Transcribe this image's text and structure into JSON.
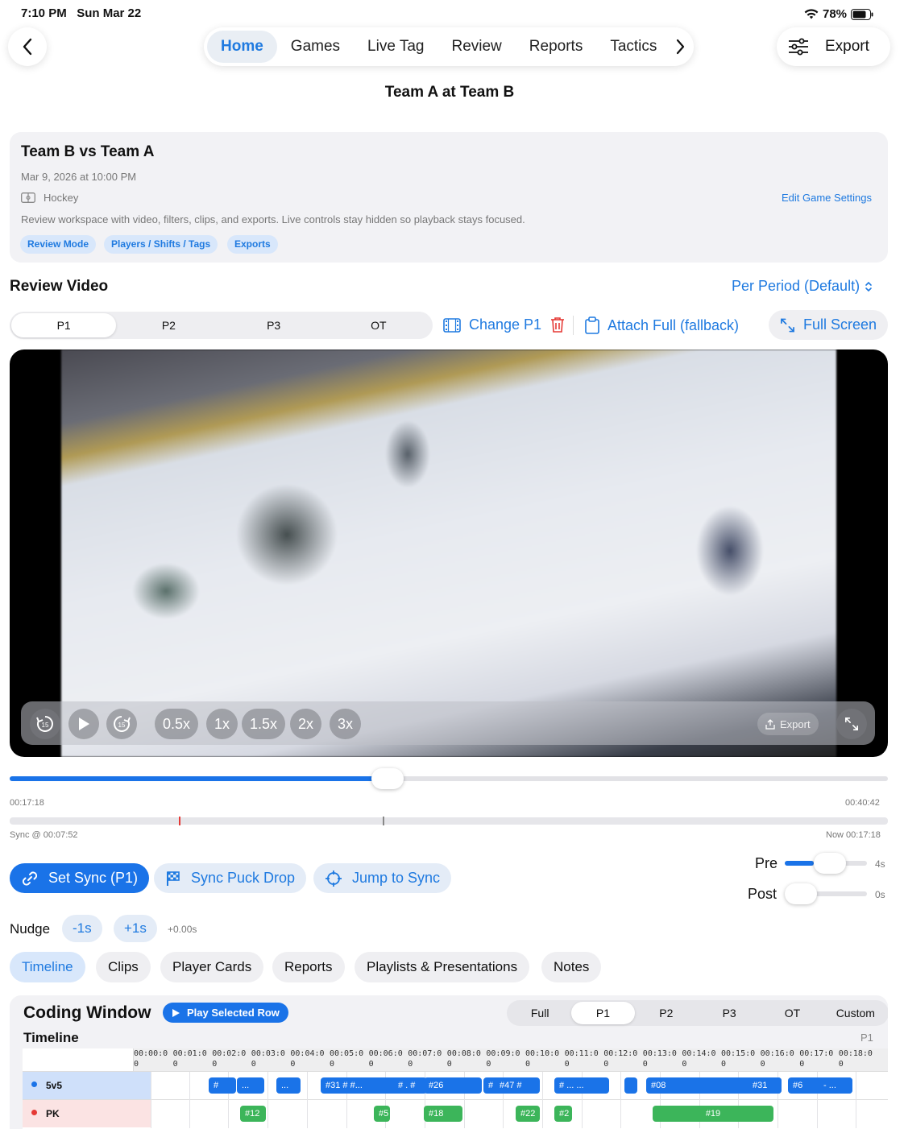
{
  "status": {
    "time": "7:10 PM",
    "date": "Sun Mar 22",
    "battery": "78%"
  },
  "nav": {
    "items": [
      "Home",
      "Games",
      "Live Tag",
      "Review",
      "Reports",
      "Tactics"
    ],
    "active": "Home",
    "export": "Export"
  },
  "title": "Team A at Team B",
  "game": {
    "title": "Team B vs Team A",
    "date": "Mar 9, 2026 at 10:00 PM",
    "sport": "Hockey",
    "edit": "Edit Game Settings",
    "desc": "Review workspace with video, filters, clips, and exports. Live controls stay hidden so playback stays focused.",
    "chips": [
      "Review Mode",
      "Players / Shifts / Tags",
      "Exports"
    ]
  },
  "review": {
    "heading": "Review Video",
    "mode": "Per Period (Default)",
    "periods": [
      "P1",
      "P2",
      "P3",
      "OT"
    ],
    "active_period": "P1",
    "change": "Change P1",
    "attach": "Attach Full (fallback)",
    "fullscreen": "Full Screen"
  },
  "player": {
    "speeds": [
      "0.5x",
      "1x",
      "1.5x",
      "2x",
      "3x"
    ],
    "export": "Export",
    "progress": 0.43,
    "current": "00:17:18",
    "duration": "00:40:42",
    "sync_label": "Sync @ 00:07:52",
    "now_label": "Now 00:17:18"
  },
  "sync": {
    "set": "Set Sync (P1)",
    "puck": "Sync Puck Drop",
    "jump": "Jump to Sync",
    "pre": "Pre",
    "pre_val": "4s",
    "post": "Post",
    "post_val": "0s",
    "pre_level": 0.35,
    "post_level": 0
  },
  "nudge": {
    "label": "Nudge",
    "minus": "-1s",
    "plus": "+1s",
    "offset": "+0.00s"
  },
  "tabs": [
    "Timeline",
    "Clips",
    "Player Cards",
    "Reports",
    "Playlists & Presentations",
    "Notes"
  ],
  "coding": {
    "title": "Coding Window",
    "play": "Play Selected Row",
    "subtitle": "Timeline",
    "period_tag": "P1",
    "periods": [
      "Full",
      "P1",
      "P2",
      "P3",
      "OT",
      "Custom"
    ],
    "active": "P1",
    "ticks": [
      "00:00:0\n0",
      "00:01:0\n0",
      "00:02:0\n0",
      "00:03:0\n0",
      "00:04:0\n0",
      "00:05:0\n0",
      "00:06:0\n0",
      "00:07:0\n0",
      "00:08:0\n0",
      "00:09:0\n0",
      "00:10:0\n0",
      "00:11:0\n0",
      "00:12:0\n0",
      "00:13:0\n0",
      "00:14:0\n0",
      "00:15:0\n0",
      "00:16:0\n0",
      "00:17:0\n0",
      "00:18:0\n0"
    ],
    "rows": [
      {
        "label": "5v5",
        "color": "#1a73e8"
      },
      {
        "label": "PK",
        "color": "#e53935"
      }
    ],
    "events5v5": [
      "#",
      "...",
      "...",
      "#31 # #...",
      "#  .  #",
      "#26",
      "#",
      "#47  #",
      "#  ...  ...",
      "",
      "#08",
      "#31",
      "#6",
      "- ..."
    ],
    "eventsPK": [
      "#12",
      "#5",
      "#18",
      "#22",
      "#2",
      "#19"
    ]
  }
}
